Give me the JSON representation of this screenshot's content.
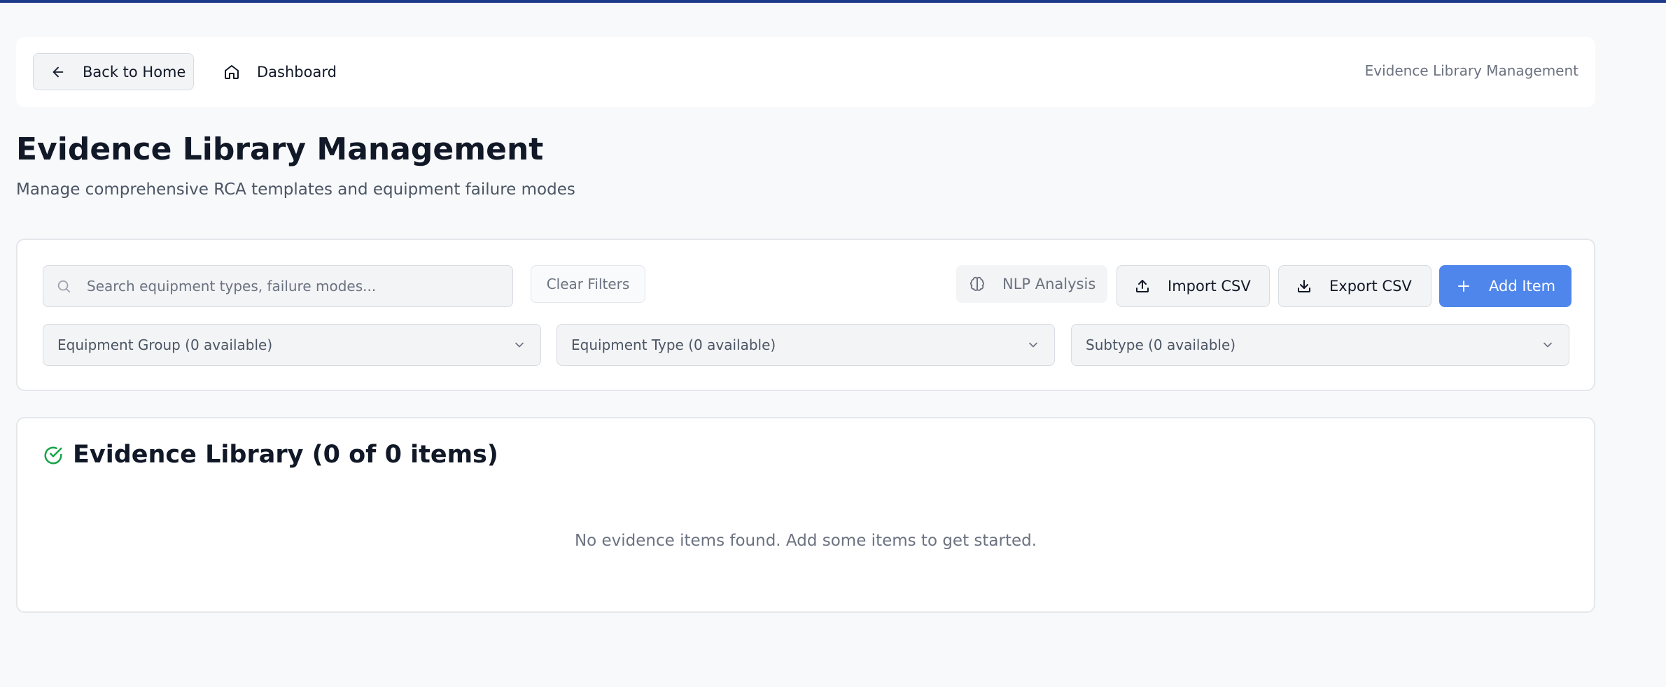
{
  "header": {
    "back_label": "Back to Home",
    "dashboard_label": "Dashboard",
    "right_title": "Evidence Library Management"
  },
  "page": {
    "title": "Evidence Library Management",
    "subtitle": "Manage comprehensive RCA templates and equipment failure modes"
  },
  "filters": {
    "search_placeholder": "Search equipment types, failure modes...",
    "search_value": "",
    "clear_label": "Clear Filters",
    "nlp_label": "NLP Analysis",
    "import_label": "Import CSV",
    "export_label": "Export CSV",
    "add_label": "Add Item",
    "equipment_group": "Equipment Group (0 available)",
    "equipment_type": "Equipment Type (0 available)",
    "subtype": "Subtype (0 available)"
  },
  "library": {
    "title": "Evidence Library (0 of 0 items)",
    "empty_message": "No evidence items found. Add some items to get started."
  },
  "icons": {
    "back": "arrow-left-icon",
    "dashboard": "home-icon",
    "search": "search-icon",
    "nlp": "brain-icon",
    "import": "upload-icon",
    "export": "download-icon",
    "add": "plus-icon",
    "select": "chevron-down-icon",
    "library": "check-circle-icon"
  },
  "colors": {
    "top_bar": "#1e3a8a",
    "primary_button": "#4f86ec",
    "success_icon": "#16a34a",
    "background": "#f8f9fb"
  }
}
